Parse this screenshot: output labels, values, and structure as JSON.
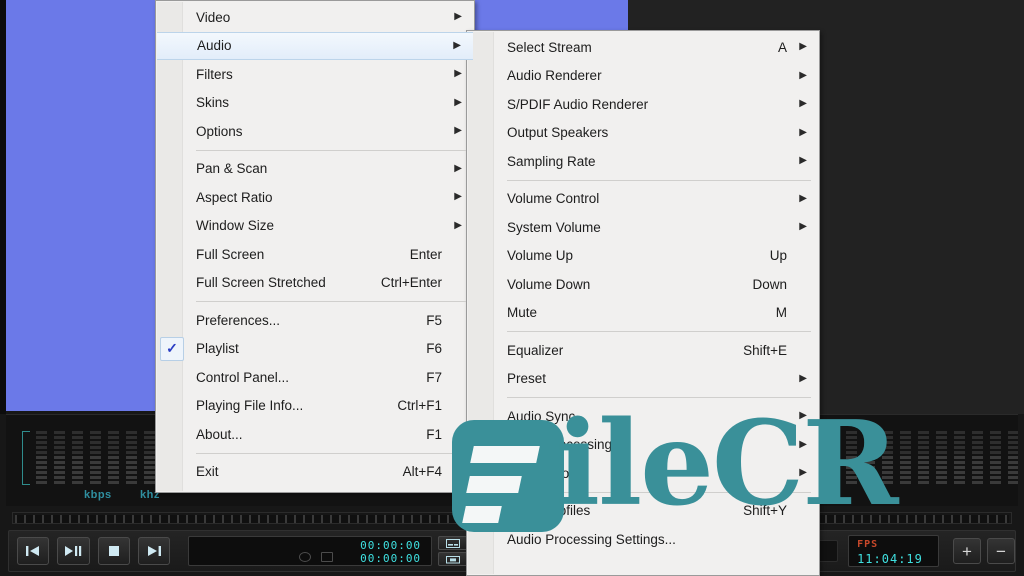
{
  "app": {
    "video_background_color": "#6b79e8",
    "watermark": {
      "text": "ileCR",
      "color": "#3a9099",
      "logo_name": "filecr-logo"
    }
  },
  "stats": {
    "bitrate_label": "kbps",
    "frequency_label": "khz"
  },
  "transport": {
    "buttons": [
      {
        "name": "previous-button",
        "glyph": "prev"
      },
      {
        "name": "play-pause-button",
        "glyph": "playpause"
      },
      {
        "name": "stop-button",
        "glyph": "stop"
      },
      {
        "name": "next-button",
        "glyph": "next"
      }
    ],
    "time_current": "00:00:00",
    "time_total": "00:00:00",
    "fps_label": "FPS",
    "clock": "11:04:19",
    "zoom_in_label": "+",
    "zoom_out_label": "−"
  },
  "main_menu": {
    "items": [
      {
        "label": "Video",
        "accel": "",
        "arrow": true,
        "selected": false,
        "checked": false
      },
      {
        "label": "Audio",
        "accel": "",
        "arrow": true,
        "selected": true,
        "checked": false
      },
      {
        "label": "Filters",
        "accel": "",
        "arrow": true,
        "selected": false,
        "checked": false
      },
      {
        "label": "Skins",
        "accel": "",
        "arrow": true,
        "selected": false,
        "checked": false
      },
      {
        "label": "Options",
        "accel": "",
        "arrow": true,
        "selected": false,
        "checked": false
      },
      {
        "separator": true
      },
      {
        "label": "Pan & Scan",
        "accel": "",
        "arrow": true,
        "selected": false,
        "checked": false
      },
      {
        "label": "Aspect Ratio",
        "accel": "",
        "arrow": true,
        "selected": false,
        "checked": false
      },
      {
        "label": "Window Size",
        "accel": "",
        "arrow": true,
        "selected": false,
        "checked": false
      },
      {
        "label": "Full Screen",
        "accel": "Enter",
        "arrow": false,
        "selected": false,
        "checked": false
      },
      {
        "label": "Full Screen Stretched",
        "accel": "Ctrl+Enter",
        "arrow": false,
        "selected": false,
        "checked": false
      },
      {
        "separator": true
      },
      {
        "label": "Preferences...",
        "accel": "F5",
        "arrow": false,
        "selected": false,
        "checked": false
      },
      {
        "label": "Playlist",
        "accel": "F6",
        "arrow": false,
        "selected": false,
        "checked": true
      },
      {
        "label": "Control Panel...",
        "accel": "F7",
        "arrow": false,
        "selected": false,
        "checked": false
      },
      {
        "label": "Playing File Info...",
        "accel": "Ctrl+F1",
        "arrow": false,
        "selected": false,
        "checked": false
      },
      {
        "label": "About...",
        "accel": "F1",
        "arrow": false,
        "selected": false,
        "checked": false
      },
      {
        "separator": true
      },
      {
        "label": "Exit",
        "accel": "Alt+F4",
        "arrow": false,
        "selected": false,
        "checked": false
      }
    ]
  },
  "sub_menu": {
    "title": "Audio",
    "items": [
      {
        "label": "Select Stream",
        "accel": "A",
        "arrow": true,
        "checked": false
      },
      {
        "label": "Audio Renderer",
        "accel": "",
        "arrow": true,
        "checked": false
      },
      {
        "label": "S/PDIF Audio Renderer",
        "accel": "",
        "arrow": true,
        "checked": false
      },
      {
        "label": "Output Speakers",
        "accel": "",
        "arrow": true,
        "checked": false
      },
      {
        "label": "Sampling Rate",
        "accel": "",
        "arrow": true,
        "checked": false
      },
      {
        "separator": true
      },
      {
        "label": "Volume Control",
        "accel": "",
        "arrow": true,
        "checked": false
      },
      {
        "label": "System Volume",
        "accel": "",
        "arrow": true,
        "checked": false
      },
      {
        "label": "Volume Up",
        "accel": "Up",
        "arrow": false,
        "checked": false
      },
      {
        "label": "Volume Down",
        "accel": "Down",
        "arrow": false,
        "checked": false
      },
      {
        "label": "Mute",
        "accel": "M",
        "arrow": false,
        "checked": false
      },
      {
        "separator": true
      },
      {
        "label": "Equalizer",
        "accel": "Shift+E",
        "arrow": false,
        "checked": false
      },
      {
        "label": "Preset",
        "accel": "",
        "arrow": true,
        "checked": false
      },
      {
        "separator": true
      },
      {
        "label": "Audio Sync",
        "accel": "",
        "arrow": true,
        "checked": false
      },
      {
        "label": "Audio Processing",
        "accel": "",
        "arrow": true,
        "checked": false
      },
      {
        "label": "Audio Boost",
        "accel": "",
        "arrow": true,
        "checked": false
      },
      {
        "separator": true
      },
      {
        "label": "Audio Profiles",
        "accel": "Shift+Y",
        "arrow": false,
        "checked": true
      },
      {
        "label": "Audio Processing Settings...",
        "accel": "",
        "arrow": false,
        "checked": false
      }
    ]
  }
}
